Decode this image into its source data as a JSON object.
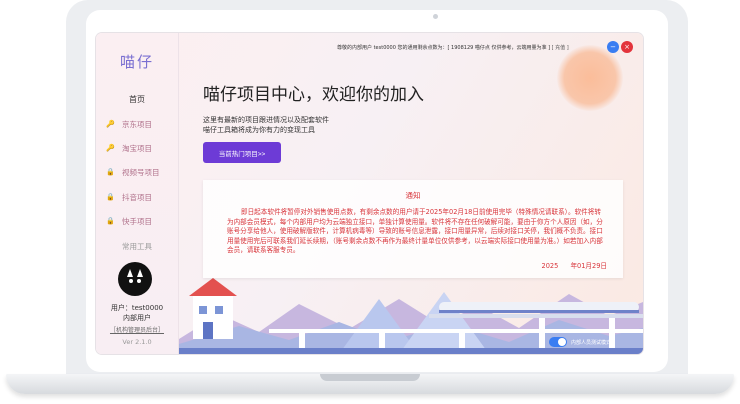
{
  "app": {
    "logo": "喵仔"
  },
  "sidebar": {
    "home": "首页",
    "items": [
      {
        "label": "京东项目"
      },
      {
        "label": "淘宝项目"
      },
      {
        "label": "视频号项目"
      },
      {
        "label": "抖音项目"
      },
      {
        "label": "快手项目"
      }
    ],
    "tools": "常用工具",
    "user_line": "用户：test0000",
    "user_role": "内部用户",
    "admin_link": "［机构管理员后台］",
    "version": "Ver 2.1.0"
  },
  "topbar": {
    "info": "尊敬的内部用户 test0000 您的通用剩余点数为：[ 1908129 喵仔点 仅供参考，云端用量为准 ]",
    "recharge": "[ 充值 ]"
  },
  "main": {
    "headline": "喵仔项目中心，欢迎你的加入",
    "desc_line1": "这里有最新的项目跟进情况以及配套软件",
    "desc_line2": "喵仔工具箱将成为你有力的变现工具",
    "cta": "当前热门项目>>"
  },
  "notice": {
    "title": "通知",
    "body": "即日起本软件将暂停对外销售使用点数，有剩余点数的用户请于2025年02月18日前使用完毕（特殊情况请联系）。软件将转为内部会员模式，每个内部用户均为云端独立接口，单独计算使用量。软件将不存在任何破解可能，要由于你方个人原因（如，分账号分享给他人，使用破解版软件，计算机病毒等）导致的账号信息泄露，接口用量异常，后续对接口关停，我们概不负责。接口用量使用完后可联系我们延长续期，（账号剩余点数不再作为最终计量单位仅供参考，以云端实际接口使用量为准。）如若加入内部会员，请联系客服专员。",
    "date_year": "2025",
    "date": "年01月29日"
  },
  "footer": {
    "toggle_label": "内部人员测试模式"
  },
  "colors": {
    "accent": "#6d3bd6",
    "notice_text": "#d8343a",
    "minimize": "#3a7df2",
    "close": "#e3343c"
  }
}
